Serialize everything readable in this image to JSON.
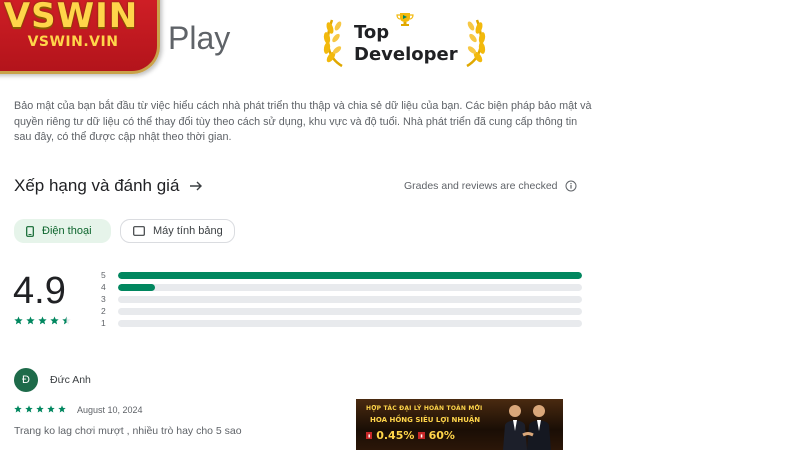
{
  "logo": {
    "brand": "VSWIN",
    "site": "VSWIN.VIN"
  },
  "store": {
    "name": "Play"
  },
  "badge": {
    "line1": "Top",
    "line2": "Developer"
  },
  "privacy": {
    "text": "Bảo mật của bạn bắt đầu từ việc hiểu cách nhà phát triển thu thập và chia sẻ dữ liệu của bạn. Các biện pháp bảo mật và quyền riêng tư dữ liệu có thể thay đổi tùy theo cách sử dụng, khu vực và độ tuổi. Nhà phát triển đã cung cấp thông tin sau đây, có thể được cập nhật theo thời gian."
  },
  "ratings": {
    "title": "Xếp hạng và đánh giá",
    "grades_note": "Grades and reviews are checked",
    "tabs": [
      {
        "label": "Điện thoại",
        "selected": true,
        "icon": "phone-icon"
      },
      {
        "label": "Máy tính bảng",
        "selected": false,
        "icon": "tablet-icon"
      }
    ],
    "score": "4.9",
    "score_stars": 4.5,
    "histogram": [
      {
        "label": "5",
        "fraction": 1.0
      },
      {
        "label": "4",
        "fraction": 0.08
      },
      {
        "label": "3",
        "fraction": 0.0
      },
      {
        "label": "2",
        "fraction": 0.0
      },
      {
        "label": "1",
        "fraction": 0.0
      }
    ]
  },
  "review": {
    "initial": "Đ",
    "name": "Đức Anh",
    "stars": 5,
    "date": "August 10, 2024",
    "text": "Trang ko lag chơi mượt , nhiều trò hay cho 5 sao"
  },
  "banner": {
    "title": "HỢP TÁC ĐẠI LÝ HOÀN TOÀN MỚI",
    "subtitle": "HOA HỒNG SIÊU LỢI NHUẬN",
    "rate1": "0.45%",
    "rate2": "60%"
  },
  "colors": {
    "accent_green": "#01875f",
    "chip_green_bg": "#e6f4ea",
    "logo_red": "#d32027",
    "logo_gold": "#ffd54a"
  }
}
